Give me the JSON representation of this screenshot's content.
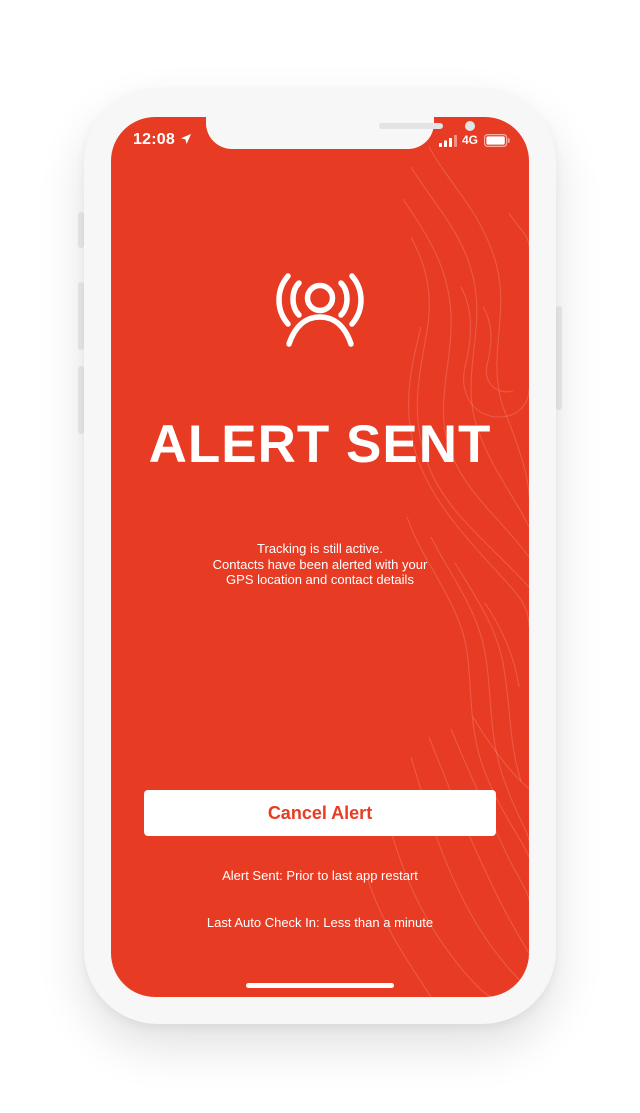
{
  "status_bar": {
    "time": "12:08",
    "network": "4G"
  },
  "alert": {
    "title": "ALERT SENT",
    "message_lines": [
      "Tracking is still active.",
      "Contacts have been alerted with your",
      "GPS location and contact details"
    ],
    "cancel_label": "Cancel Alert",
    "alert_sent_info": "Alert Sent: Prior to last app restart",
    "last_check_in_info": "Last Auto Check In: Less than a minute"
  },
  "colors": {
    "screen_background": "#e83b23",
    "button_background": "#ffffff",
    "button_text": "#e83b23",
    "phone_frame": "#f7f7f8"
  },
  "icons": {
    "status_location": "location-arrow-icon",
    "status_signal": "cellular-signal-icon",
    "status_battery": "battery-icon",
    "alert": "person-broadcast-icon"
  }
}
